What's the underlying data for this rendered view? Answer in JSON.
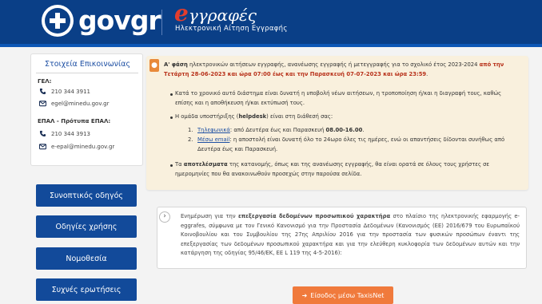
{
  "header": {
    "logo_gov": "gov",
    "logo_gr": "gr",
    "brand_e": "e",
    "brand_rest": "γγραφές",
    "brand_sub": "Ηλεκτρονική Αίτηση Εγγραφής"
  },
  "contacts": {
    "title": "Στοιχεία Επικοινωνίας",
    "gel_label": "ΓΕΛ:",
    "gel_phone": "210 344 3911",
    "gel_email": "egel@minedu.gov.gr",
    "epal_label": "ΕΠΑΛ - Πρότυπα ΕΠΑΛ:",
    "epal_phone": "210 344 3913",
    "epal_email": "e-epal@minedu.gov.gr",
    "icons": [
      "phone-icon",
      "email-icon"
    ]
  },
  "sidebar": {
    "buttons": [
      {
        "label": "Συνοπτικός οδηγός"
      },
      {
        "label": "Οδηγίες χρήσης"
      },
      {
        "label": "Νομοθεσία"
      },
      {
        "label": "Συχνές ερωτήσεις"
      }
    ]
  },
  "notice": {
    "phase": "Α' φάση",
    "intro": " ηλεκτρονικών αιτήσεων εγγραφής, ανανέωσης εγγραφής ή μετεγγραφής για το σχολικό έτος 2023-2024 ",
    "from": "από",
    "dates": "την Τετάρτη 28-06-2023 και ώρα 07:00 έως και την Παρασκευή 07-07-2023 και ώρα 23:59",
    "dot": ".",
    "bullet1": "Κατά το χρονικό αυτό διάστημα είναι δυνατή η υποβολή νέων αιτήσεων, η τροποποίηση ή/και η διαγραφή τους, καθώς επίσης και η αποθήκευση ή/και εκτύπωσή τους.",
    "bullet2_pre": "Η ομάδα υποστήριξης (",
    "bullet2_help": "helpdesk",
    "bullet2_post": ") είναι στη διάθεσή σας:",
    "sub1_link": "Τηλεφωνικά",
    "sub1_text": ": από Δευτέρα έως και Παρασκευή ",
    "sub1_hours": "08.00-16.00",
    "sub1_dot": ".",
    "sub2_link": "Μέσω email",
    "sub2_text": ": η αποστολή είναι δυνατή όλο το 24ωρο όλες τις ημέρες, ενώ οι απαντήσεις δίδονται συνήθως από Δευτέρα έως και Παρασκευή.",
    "sub_num1": "1.",
    "sub_num2": "2.",
    "bullet3_pre": "Τα ",
    "bullet3_bold": "αποτελέσματα",
    "bullet3_post": " της κατανομής, όπως και της ανανέωσης εγγραφής, θα είναι ορατά σε όλους τους χρήστες σε ημερομηνίες που θα ανακοινωθούν προσεχώς στην παρούσα σελίδα."
  },
  "gdpr": {
    "pre": "Ενημέρωση για την ",
    "bold": "επεξεργασία δεδομένων προσωπικού χαρακτήρα",
    "post": " στο πλαίσιο της ηλεκτρονικής εφαρμογής e-eggrafes, σύμφωνα με τον Γενικό Κανονισμό για την Προστασία Δεδομένων (Κανονισμός (ΕΕ) 2016/679 του Ευρωπαϊκού Κοινοβουλίου και του Συμβουλίου της 27ης Απριλίου 2016 για την προστασία των φυσικών προσώπων έναντι της επεξεργασίας των δεδομένων προσωπικού χαρακτήρα και για την ελεύθερη κυκλοφορία των δεδομένων αυτών και την κατάργηση της οδηγίας 95/46/ΕΚ, ΕΕ L 119 της 4-5-2016):"
  },
  "login": {
    "label": "Είσοδος μέσω TaxisNet"
  },
  "colors": {
    "header_bg": "#0a3f87",
    "button_bg": "#124a9a",
    "notice_bg": "#f9f0dd",
    "accent_red": "#b8321b",
    "login_bg": "#f07a3c"
  }
}
